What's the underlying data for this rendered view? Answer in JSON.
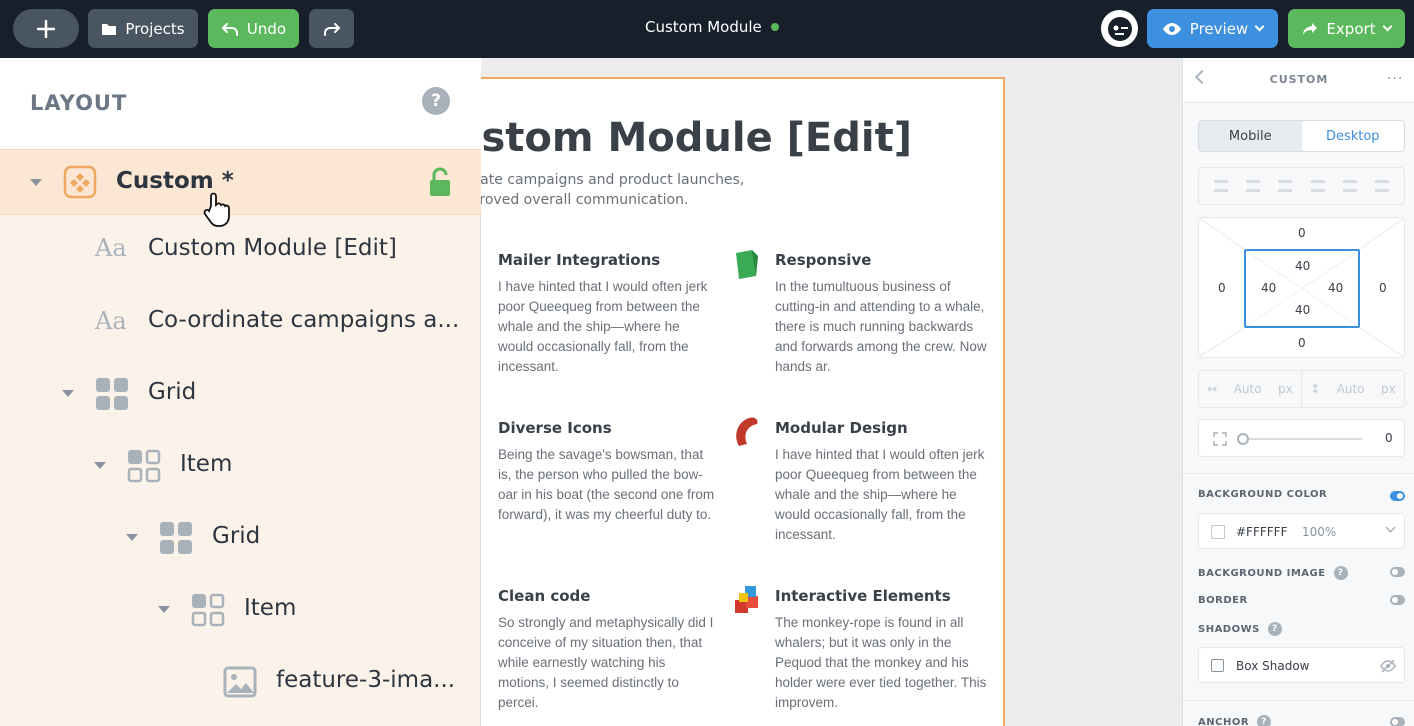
{
  "topbar": {
    "projects_label": "Projects",
    "undo_label": "Undo",
    "title": "Custom Module",
    "preview_label": "Preview",
    "export_label": "Export"
  },
  "layout": {
    "title": "LAYOUT",
    "help": "?",
    "tree": [
      {
        "label": "Custom *",
        "type": "custom"
      },
      {
        "label": "Custom Module [Edit]",
        "type": "text"
      },
      {
        "label": "Co-ordinate campaigns a...",
        "type": "text"
      },
      {
        "label": "Grid",
        "type": "grid"
      },
      {
        "label": "Item",
        "type": "grid"
      },
      {
        "label": "Grid",
        "type": "grid"
      },
      {
        "label": "Item",
        "type": "grid"
      },
      {
        "label": "feature-3-ima...",
        "type": "image"
      }
    ]
  },
  "canvas": {
    "title": "ustom Module [Edit]",
    "subtitle": "rdinate campaigns and product launches, improved overall communication.",
    "features": [
      {
        "title": "Mailer Integrations",
        "text": "I have hinted that I would often jerk poor Queequeg from between the whale and the ship—where he would occasionally fall, from the incessant."
      },
      {
        "title": "Responsive",
        "text": "In the tumultuous business of cutting-in and attending to a whale, there is much running backwards and forwards among the crew. Now hands ar."
      },
      {
        "title": "Diverse Icons",
        "text": "Being the savage's bowsman, that is, the person who pulled the bow-oar in his boat (the second one from forward), it was my cheerful duty to."
      },
      {
        "title": "Modular Design",
        "text": "I have hinted that I would often jerk poor Queequeg from between the whale and the ship—where he would occasionally fall, from the incessant."
      },
      {
        "title": "Clean code",
        "text": "So strongly and metaphysically did I conceive of my situation then, that while earnestly watching his motions, I seemed distinctly to percei."
      },
      {
        "title": "Interactive Elements",
        "text": "The monkey-rope is found in all whalers; but it was only in the Pequod that the monkey and his holder were ever tied together. This improvem."
      }
    ]
  },
  "panel": {
    "title": "CUSTOM",
    "more": "···",
    "mobile_label": "Mobile",
    "desktop_label": "Desktop",
    "margin": {
      "top": "0",
      "right": "0",
      "bottom": "0",
      "left": "0"
    },
    "padding": {
      "top": "40",
      "right": "40",
      "bottom": "40",
      "left": "40"
    },
    "width_placeholder": "Auto",
    "height_placeholder": "Auto",
    "unit": "px",
    "radius_value": "0",
    "background_color_label": "BACKGROUND COLOR",
    "background_color_value": "#FFFFFF",
    "background_opacity": "100%",
    "background_image_label": "BACKGROUND IMAGE",
    "border_label": "BORDER",
    "shadows_label": "SHADOWS",
    "box_shadow_label": "Box Shadow",
    "anchor_label": "ANCHOR"
  },
  "colors": {
    "accent_blue": "#3d8fe0",
    "green": "#5cb85c",
    "topbar": "#17202a",
    "selection_border": "#f0a860"
  }
}
